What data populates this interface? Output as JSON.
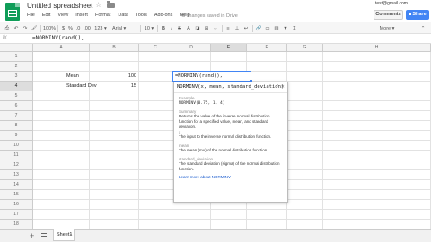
{
  "header": {
    "title": "Untitled spreadsheet",
    "menus": [
      "File",
      "Edit",
      "View",
      "Insert",
      "Format",
      "Data",
      "Tools",
      "Add-ons",
      "Help"
    ],
    "status": "All changes saved in Drive",
    "user": "test@gmail.com",
    "comments_label": "Comments",
    "share_label": "Share"
  },
  "toolbar": {
    "zoom": "100%",
    "currency": "$",
    "percent": "%",
    "decimals_dec": ".0",
    "decimals_inc": ".00",
    "number_format": "123 ▾",
    "font": "Arial ▾",
    "font_size": "10 ▾",
    "bold": "B",
    "italic": "I",
    "strike": "S",
    "more": "More ▾"
  },
  "formula_bar": {
    "label": "fx",
    "value": "=NORMINV(rand(),"
  },
  "grid": {
    "columns": [
      "A",
      "B",
      "C",
      "D",
      "E",
      "F",
      "G",
      "H"
    ],
    "rows": [
      "1",
      "2",
      "3",
      "4",
      "5",
      "6",
      "7",
      "8",
      "9",
      "10",
      "11",
      "12",
      "13",
      "14",
      "15",
      "16",
      "17",
      "18"
    ],
    "cells": {
      "B4": "Mean",
      "C4": "100",
      "B5": "Standard Dev",
      "C5": "15",
      "E4": "=NORMINV(rand(),"
    }
  },
  "help": {
    "signature": "NORMINV(x, mean, standard_deviation)",
    "example_heading": "Example",
    "example": "NORMINV(0.75, 1, 4)",
    "summary_heading": "Summary",
    "summary": "Returns the value of the inverse normal distribution function for a specified value, mean, and standard deviation.",
    "x_heading": "x",
    "x_desc": "The input to the inverse normal distribution function.",
    "mean_heading": "mean",
    "mean_desc": "The mean (mu) of the normal distribution function.",
    "sd_heading": "standard_deviation",
    "sd_desc": "The standard deviation (sigma) of the normal distribution function.",
    "learn_more": "Learn more about NORMINV"
  },
  "bottom": {
    "add_sheet": "+",
    "sheet_name": "Sheet1"
  }
}
